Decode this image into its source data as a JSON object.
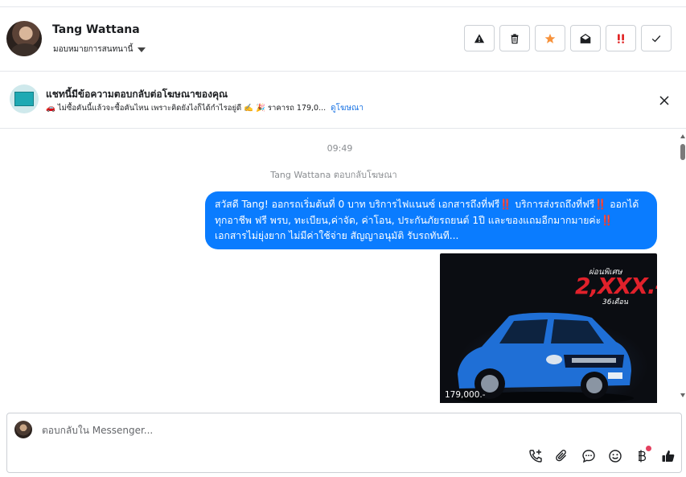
{
  "header": {
    "contact_name": "Tang Wattana",
    "assign_label": "มอบหมายการสนทนานี้",
    "action_icons": [
      "spam-icon",
      "trash-icon",
      "star-icon",
      "mark-unread-icon",
      "follow-up-icon",
      "done-icon"
    ]
  },
  "banner": {
    "title": "แชทนี้มีข้อความตอบกลับต่อโฆษณาของคุณ",
    "subtitle": "🚗 ไม่ซื้อคันนี้แล้วจะซื้อคันไหน เพราะคิดยังไงก็ได้กำไรอยู่ดี ✍️ 🎉 ราคารถ 179,0...",
    "link": "ดูโฆษณา"
  },
  "chat": {
    "time": "09:49",
    "reply_note": "Tang Wattana ตอบกลับโฆษณา",
    "message": "สวัสดี Tang! ออกรถเริ่มต้นที่ 0 บาท บริการไฟแนนซ์ เอกสารถึงที่ฟรี‼️ บริการส่งรถถึงที่ฟรี‼️ ออกได้ทุกอาชีพ ฟรี พรบ, ทะเบียน,ค่าจัด, ค่าโอน, ประกันภัยรถยนต์ 1ปี และของแถมอีกมากมายค่ะ‼️ เอกสารไม่ยุ่งยาก ไม่มีค่าใช้จ่าย สัญญาอนุมัติ รับรถทันที...",
    "card": {
      "promo_small": "ผ่อนพิเศษ",
      "promo_big": "2,XXX.-",
      "promo_months": "36เดือน",
      "price": "179,000.-",
      "car_color": "#1f6fd6"
    }
  },
  "composer": {
    "placeholder": "ตอบกลับใน Messenger...",
    "tool_icons": [
      "call-icon",
      "attachment-icon",
      "saved-reply-icon",
      "emoji-icon",
      "payment-icon",
      "like-icon"
    ]
  },
  "colors": {
    "accent": "#0a7cff",
    "star": "#f7923b",
    "follow_up": "#e02020",
    "link": "#1b74e4"
  }
}
